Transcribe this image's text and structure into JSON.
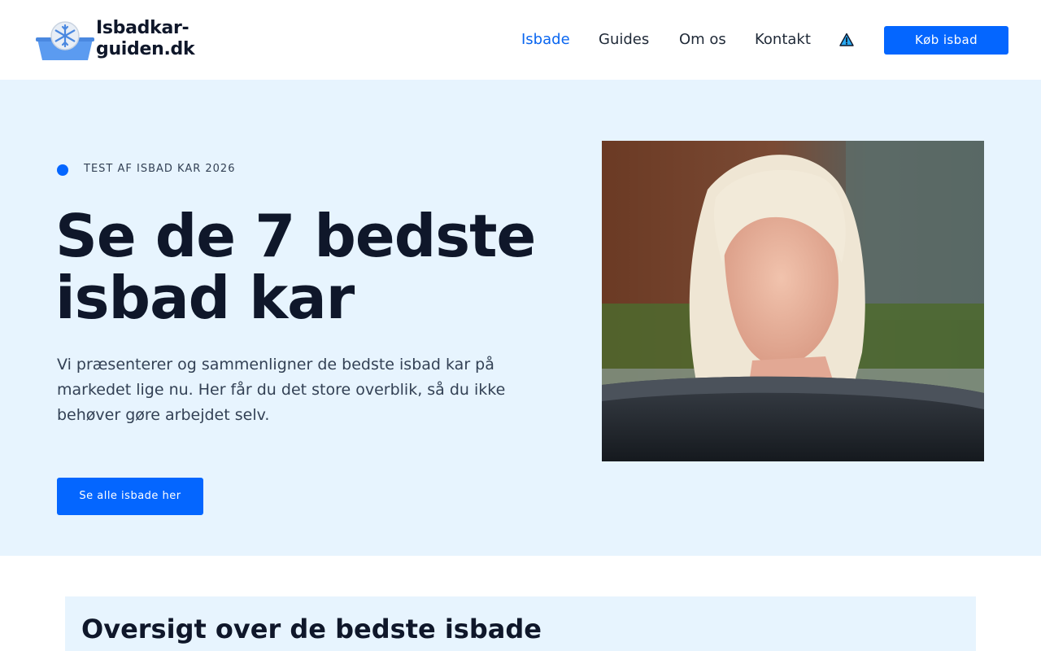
{
  "header": {
    "logo": {
      "line1": "Isbadkar-",
      "line2": "guiden.dk"
    },
    "nav": [
      {
        "label": "Isbade",
        "active": true
      },
      {
        "label": "Guides",
        "active": false
      },
      {
        "label": "Om os",
        "active": false
      },
      {
        "label": "Kontakt",
        "active": false
      }
    ],
    "warning_icon": "warning-triangle-icon",
    "buy_button": "Køb isbad"
  },
  "hero": {
    "eyebrow": "TEST AF ISBAD KAR 2026",
    "title": "Se de 7 bedste isbad kar",
    "text": "Vi præsenterer og sammenligner de bedste isbad kar på markedet lige nu. Her får du det store overblik, så du ikke behøver gøre arbejdet selv.",
    "button": "Se alle isbade her"
  },
  "overview": {
    "title": "Oversigt over de bedste isbade"
  },
  "colors": {
    "accent": "#0466ff",
    "hero_background": "#e7f4fe",
    "heading": "#0f172a",
    "body_text": "#334155"
  }
}
